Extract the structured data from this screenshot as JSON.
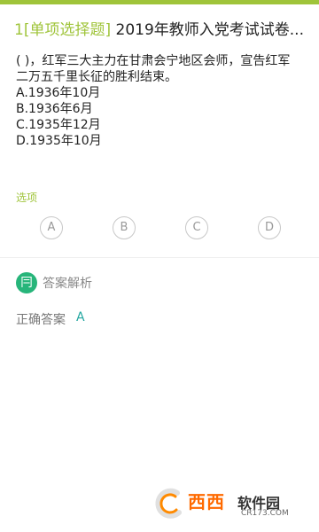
{
  "colors": {
    "accent": "#9fc43a",
    "analysis_icon": "#27b57a",
    "answer": "#22a6a0"
  },
  "question": {
    "number": "1",
    "type": "[单项选择题]",
    "title": "2019年教师入党考试试卷...",
    "stem_lines": [
      "( )，红军三大主力在甘肃会宁地区会师，宣告红军",
      "二万五千里长征的胜利结束。"
    ],
    "choices": [
      "A.1936年10月",
      "B.1936年6月",
      "C.1935年12月",
      "D.1935年10月"
    ]
  },
  "options_section": {
    "label": "选项",
    "buttons": [
      "A",
      "B",
      "C",
      "D"
    ]
  },
  "analysis": {
    "icon": "analysis-book-icon",
    "icon_glyph": "冃",
    "title": "答案解析"
  },
  "answer": {
    "label": "正确答案",
    "value": "A"
  },
  "watermark": {
    "brand": "西西",
    "site": "软件园",
    "url": "CR173.COM"
  }
}
